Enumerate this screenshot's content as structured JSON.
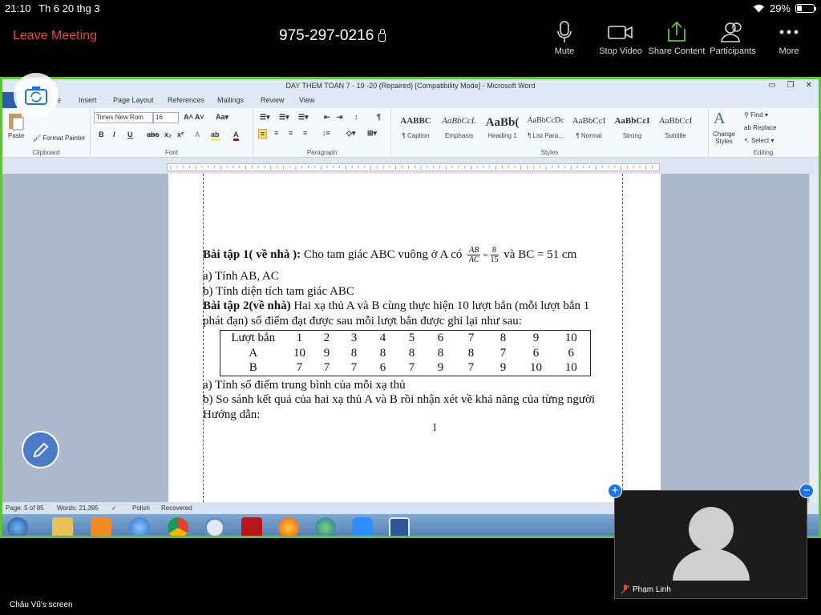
{
  "status_bar": {
    "time": "21:10",
    "date": "Th 6 20 thg 3",
    "battery": "29%",
    "battery_level": 0.29
  },
  "zoom": {
    "leave_label": "Leave Meeting",
    "meeting_id": "975-297-0216",
    "buttons": {
      "mute": "Mute",
      "stop_video": "Stop Video",
      "share": "Share Content",
      "participants": "Participants",
      "more": "More"
    },
    "accent_color": "#5fc43d",
    "leave_color": "#e64c3c"
  },
  "word": {
    "title": "DAY THEM TOAN 7 - 19 -20 (Repaired) [Compatibility Mode] - Microsoft Word",
    "tabs": {
      "home": "e",
      "insert": "Insert",
      "page_layout": "Page Layout",
      "references": "References",
      "mailings": "Mailings",
      "review": "Review",
      "view": "View"
    },
    "ribbon": {
      "paste": "Paste",
      "format_painter": "Format Painter",
      "font_name": "Times New Rom",
      "font_size": "16",
      "groups": {
        "clipboard": "Clipboard",
        "font": "Font",
        "paragraph": "Paragraph",
        "styles": "Styles",
        "editing": "Editing"
      },
      "styles": [
        {
          "preview": "AABBC",
          "label": "¶ Caption"
        },
        {
          "preview": "AaBbCcL",
          "label": "Emphasis"
        },
        {
          "preview": "AaBb(",
          "label": "Heading 1"
        },
        {
          "preview": "AaBbCcDc",
          "label": "¶ List Para..."
        },
        {
          "preview": "AaBbCcI",
          "label": "¶ Normal"
        },
        {
          "preview": "AaBbCcI",
          "label": "Strong"
        },
        {
          "preview": "AaBbCcI",
          "label": "Subtitle"
        }
      ],
      "change_styles": "Change Styles",
      "find": "Find",
      "replace": "Replace",
      "select": "Select"
    },
    "document": {
      "ex1_title": "Bài tập 1( về nhà ):",
      "ex1_text": "Cho tam giác ABC vuông ở A có",
      "frac1_num": "AB",
      "frac1_den": "AC",
      "equals": "=",
      "frac2_num": "8",
      "frac2_den": "15",
      "ex1_tail": "và BC = 51 cm",
      "ex1_a": "a) Tính AB, AC",
      "ex1_b": "b) Tính diện tích tam giác ABC",
      "ex2_title": "Bài tập 2(về nhà)",
      "ex2_text": "Hai xạ thủ A và B cùng thực hiện 10 lượt bắn (mỗi lượt bắn 1",
      "ex2_text2": "phát đạn) số điểm đạt được sau mỗi lượt bắn được ghi lại như sau:",
      "table": [
        [
          "Lượt bắn",
          "1",
          "2",
          "3",
          "4",
          "5",
          "6",
          "7",
          "8",
          "9",
          "10"
        ],
        [
          "A",
          "10",
          "9",
          "8",
          "8",
          "8",
          "8",
          "8",
          "7",
          "6",
          "6"
        ],
        [
          "B",
          "7",
          "7",
          "7",
          "6",
          "7",
          "9",
          "7",
          "9",
          "10",
          "10"
        ]
      ],
      "ex2_a": "a) Tính số điểm trung bình của mỗi xạ thủ",
      "ex2_b": "b) So sánh kết quả của hai xạ thủ A và B rồi nhận xét về khả năng của từng người",
      "guide": "Hướng dẫn:"
    },
    "statusbar": {
      "page": "Page: 5 of 85",
      "words": "Words: 21,395",
      "language": "Polish",
      "recovered": "Recovered"
    }
  },
  "video": {
    "participant": "Phạm Linh"
  },
  "screen_owner": "Châu Vũ's screen"
}
